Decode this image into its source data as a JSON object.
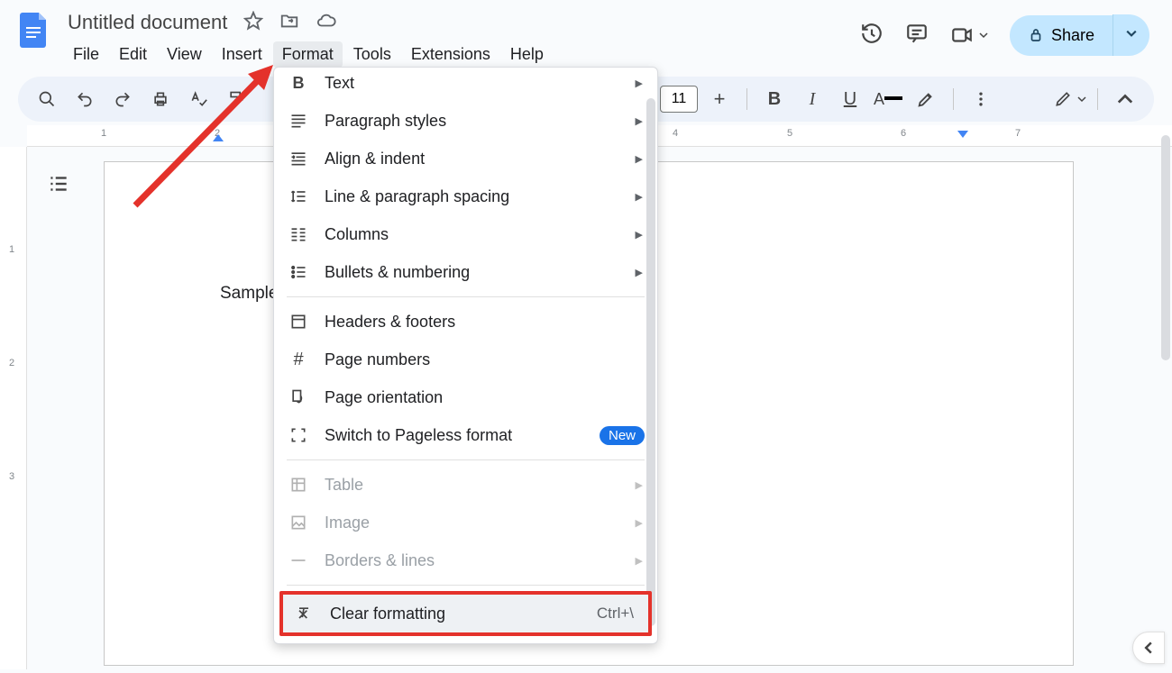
{
  "doc": {
    "title": "Untitled document"
  },
  "menus": {
    "file": "File",
    "edit": "Edit",
    "view": "View",
    "insert": "Insert",
    "format": "Format",
    "tools": "Tools",
    "extensions": "Extensions",
    "help": "Help"
  },
  "toolbar": {
    "font_size": "11"
  },
  "share": {
    "label": "Share"
  },
  "ruler": {
    "h": [
      "1",
      "2",
      "4",
      "5",
      "6",
      "7"
    ],
    "v": [
      "1",
      "2",
      "3"
    ]
  },
  "page": {
    "content": "Sample"
  },
  "format_menu": {
    "text": "Text",
    "paragraph": "Paragraph styles",
    "align": "Align & indent",
    "line": "Line & paragraph spacing",
    "columns": "Columns",
    "bullets": "Bullets & numbering",
    "headers": "Headers & footers",
    "pagenum": "Page numbers",
    "orientation": "Page orientation",
    "pageless": "Switch to Pageless format",
    "pageless_badge": "New",
    "table": "Table",
    "image": "Image",
    "borders": "Borders & lines",
    "clear": "Clear formatting",
    "clear_shortcut": "Ctrl+\\"
  }
}
